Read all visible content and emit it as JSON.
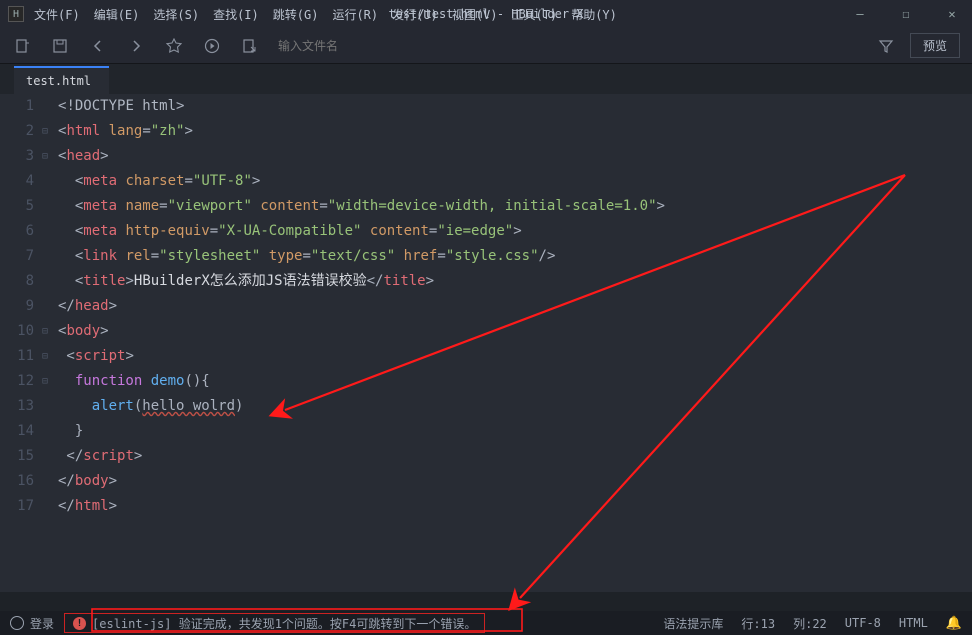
{
  "window": {
    "title": "test/test.html - HBuilder X"
  },
  "menu": {
    "items": [
      "文件(F)",
      "编辑(E)",
      "选择(S)",
      "查找(I)",
      "跳转(G)",
      "运行(R)",
      "发行(U)",
      "视图(V)",
      "工具(T)",
      "帮助(Y)"
    ]
  },
  "toolbar": {
    "filename_placeholder": "输入文件名",
    "preview_label": "预览"
  },
  "tabs": {
    "active": "test.html"
  },
  "code": {
    "lines": [
      {
        "n": 1,
        "fold": "",
        "seg": [
          {
            "c": "c-punct",
            "t": "<"
          },
          {
            "c": "c-doc",
            "t": "!DOCTYPE html"
          },
          {
            "c": "c-punct",
            "t": ">"
          }
        ]
      },
      {
        "n": 2,
        "fold": "⊟",
        "seg": [
          {
            "c": "c-punct",
            "t": "<"
          },
          {
            "c": "c-tag",
            "t": "html"
          },
          {
            "c": "c-attr",
            "t": " lang"
          },
          {
            "c": "c-punct",
            "t": "="
          },
          {
            "c": "c-str",
            "t": "\"zh\""
          },
          {
            "c": "c-punct",
            "t": ">"
          }
        ]
      },
      {
        "n": 3,
        "fold": "⊟",
        "seg": [
          {
            "c": "c-punct",
            "t": "<"
          },
          {
            "c": "c-tag",
            "t": "head"
          },
          {
            "c": "c-punct",
            "t": ">"
          }
        ]
      },
      {
        "n": 4,
        "fold": "",
        "seg": [
          {
            "c": "c-punct",
            "t": "  <"
          },
          {
            "c": "c-tag",
            "t": "meta"
          },
          {
            "c": "c-attr",
            "t": " charset"
          },
          {
            "c": "c-punct",
            "t": "="
          },
          {
            "c": "c-str",
            "t": "\"UTF-8\""
          },
          {
            "c": "c-punct",
            "t": ">"
          }
        ]
      },
      {
        "n": 5,
        "fold": "",
        "seg": [
          {
            "c": "c-punct",
            "t": "  <"
          },
          {
            "c": "c-tag",
            "t": "meta"
          },
          {
            "c": "c-attr",
            "t": " name"
          },
          {
            "c": "c-punct",
            "t": "="
          },
          {
            "c": "c-str",
            "t": "\"viewport\""
          },
          {
            "c": "c-attr",
            "t": " content"
          },
          {
            "c": "c-punct",
            "t": "="
          },
          {
            "c": "c-str",
            "t": "\"width=device-width, initial-scale=1.0\""
          },
          {
            "c": "c-punct",
            "t": ">"
          }
        ]
      },
      {
        "n": 6,
        "fold": "",
        "seg": [
          {
            "c": "c-punct",
            "t": "  <"
          },
          {
            "c": "c-tag",
            "t": "meta"
          },
          {
            "c": "c-attr",
            "t": " http-equiv"
          },
          {
            "c": "c-punct",
            "t": "="
          },
          {
            "c": "c-str",
            "t": "\"X-UA-Compatible\""
          },
          {
            "c": "c-attr",
            "t": " content"
          },
          {
            "c": "c-punct",
            "t": "="
          },
          {
            "c": "c-str",
            "t": "\"ie=edge\""
          },
          {
            "c": "c-punct",
            "t": ">"
          }
        ]
      },
      {
        "n": 7,
        "fold": "",
        "seg": [
          {
            "c": "c-punct",
            "t": "  <"
          },
          {
            "c": "c-tag",
            "t": "link"
          },
          {
            "c": "c-attr",
            "t": " rel"
          },
          {
            "c": "c-punct",
            "t": "="
          },
          {
            "c": "c-str",
            "t": "\"stylesheet\""
          },
          {
            "c": "c-attr",
            "t": " type"
          },
          {
            "c": "c-punct",
            "t": "="
          },
          {
            "c": "c-str",
            "t": "\"text/css\""
          },
          {
            "c": "c-attr",
            "t": " href"
          },
          {
            "c": "c-punct",
            "t": "="
          },
          {
            "c": "c-str",
            "t": "\"style.css\""
          },
          {
            "c": "c-punct",
            "t": "/>"
          }
        ]
      },
      {
        "n": 8,
        "fold": "",
        "seg": [
          {
            "c": "c-punct",
            "t": "  <"
          },
          {
            "c": "c-tag",
            "t": "title"
          },
          {
            "c": "c-punct",
            "t": ">"
          },
          {
            "c": "c-txt",
            "t": "HBuilderX怎么添加JS语法错误校验"
          },
          {
            "c": "c-punct",
            "t": "</"
          },
          {
            "c": "c-tag",
            "t": "title"
          },
          {
            "c": "c-punct",
            "t": ">"
          }
        ]
      },
      {
        "n": 9,
        "fold": "",
        "seg": [
          {
            "c": "c-punct",
            "t": "</"
          },
          {
            "c": "c-tag",
            "t": "head"
          },
          {
            "c": "c-punct",
            "t": ">"
          }
        ]
      },
      {
        "n": 10,
        "fold": "⊟",
        "seg": [
          {
            "c": "c-punct",
            "t": "<"
          },
          {
            "c": "c-tag",
            "t": "body"
          },
          {
            "c": "c-punct",
            "t": ">"
          }
        ]
      },
      {
        "n": 11,
        "fold": "⊟",
        "seg": [
          {
            "c": "c-punct",
            "t": " <"
          },
          {
            "c": "c-tag",
            "t": "script"
          },
          {
            "c": "c-punct",
            "t": ">"
          }
        ]
      },
      {
        "n": 12,
        "fold": "⊟",
        "seg": [
          {
            "c": "c-key",
            "t": "  function"
          },
          {
            "c": "c-fn",
            "t": " demo"
          },
          {
            "c": "c-punct",
            "t": "(){"
          }
        ]
      },
      {
        "n": 13,
        "fold": "",
        "seg": [
          {
            "c": "c-fn",
            "t": "    alert"
          },
          {
            "c": "c-punct",
            "t": "("
          },
          {
            "c": "c-invalid",
            "t": "hello wolrd"
          },
          {
            "c": "c-punct",
            "t": ")"
          }
        ]
      },
      {
        "n": 14,
        "fold": "",
        "seg": [
          {
            "c": "c-punct",
            "t": "  }"
          }
        ]
      },
      {
        "n": 15,
        "fold": "",
        "seg": [
          {
            "c": "c-punct",
            "t": " </"
          },
          {
            "c": "c-tag",
            "t": "script"
          },
          {
            "c": "c-punct",
            "t": ">"
          }
        ]
      },
      {
        "n": 16,
        "fold": "",
        "seg": [
          {
            "c": "c-punct",
            "t": "</"
          },
          {
            "c": "c-tag",
            "t": "body"
          },
          {
            "c": "c-punct",
            "t": ">"
          }
        ]
      },
      {
        "n": 17,
        "fold": "",
        "seg": [
          {
            "c": "c-punct",
            "t": "</"
          },
          {
            "c": "c-tag",
            "t": "html"
          },
          {
            "c": "c-punct",
            "t": ">"
          }
        ]
      }
    ]
  },
  "status": {
    "login": "登录",
    "error_msg": "[eslint-js] 验证完成，共发现1个问题。按F4可跳转到下一个错误。",
    "syntax_hint": "语法提示库",
    "line_label": "行:13",
    "col_label": "列:22",
    "encoding": "UTF-8",
    "lang": "HTML"
  }
}
